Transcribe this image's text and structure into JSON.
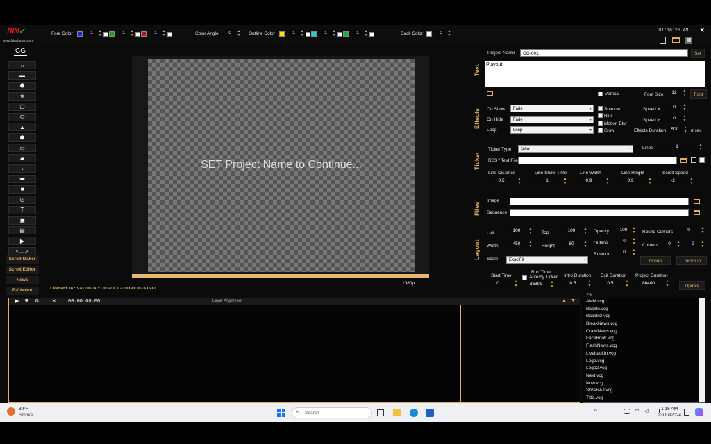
{
  "topbar": {
    "logo_text": "www.binstudeo.com",
    "logo_brand": "BIN",
    "fore_color_label": "Fore Color",
    "color_angle_label": "Color Angle",
    "outline_color_label": "Outline Color",
    "back_color_label": "Back Color",
    "fore_swatches": [
      {
        "color": "#1a2fd0",
        "value": "1"
      },
      {
        "color": "#1fa02a",
        "value": "1"
      },
      {
        "color": "#b01818",
        "value": "1"
      }
    ],
    "angle_value": "0",
    "outline_swatches": [
      {
        "color": "#ffe000",
        "value": "1"
      },
      {
        "color": "#18d0e0",
        "value": "1"
      },
      {
        "color": "#18b030",
        "value": "1"
      }
    ],
    "back_value": "0",
    "clock": "01:16:26 AM",
    "close": "✕"
  },
  "sidebar": {
    "cg_label": "CG",
    "tools": [
      "circle",
      "rounded-rect",
      "pentagon",
      "star",
      "rounded-square",
      "pill",
      "triangle",
      "hexagon",
      "rectangle",
      "parallelogram",
      "crescent",
      "double-arrow",
      "square",
      "clock",
      "text",
      "image",
      "film",
      "video",
      "dots"
    ],
    "dots_label": "<......>",
    "buttons": [
      "Scroll Maker",
      "Scroll Editor",
      "News",
      "E-Choice"
    ]
  },
  "canvas": {
    "message": "SET Project Name to Continue...",
    "resolution": "1080p",
    "license": "Licensed To : SALMAN YOUSAF LAHORE PAKISTA"
  },
  "panel": {
    "project_name_label": "Project Name",
    "project_name_value": "CG-001",
    "set_label": "Set",
    "text_section": "Text",
    "text_value": "Playout",
    "vertical_label": "Vertical",
    "font_size_label": "Font Size",
    "font_size_value": "12",
    "font_label": "Font",
    "effects_section": "Effects",
    "on_show_label": "On Show",
    "on_show_value": "Fade",
    "on_hide_label": "On Hide",
    "on_hide_value": "Fade",
    "loop_label": "Loop",
    "loop_value": "Loop",
    "shadow_label": "Shadow",
    "blur_label": "Blur",
    "motion_blur_label": "Motion Blur",
    "glow_label": "Glow",
    "speed_x_label": "Speed X",
    "speed_x_value": "0",
    "speed_y_label": "Speed Y",
    "speed_y_value": "0",
    "effects_duration_label": "Effects Duration",
    "effects_duration_value": "500",
    "msec_label": "msec",
    "ticker_section": "Ticker",
    "ticker_type_label": "Ticker Type",
    "ticker_type_value": "crawl",
    "lines_label": "Lines",
    "lines_value": "1",
    "rss_label": "RSS / Text File",
    "line_distance_label": "Line Distance",
    "line_distance_value": "0.5",
    "line_show_time_label": "Line Show Time",
    "line_show_time_value": "1",
    "line_width_label": "Line Width",
    "line_width_value": "0.9",
    "line_height_label": "Line Height",
    "line_height_value": "0.9",
    "scroll_speed_label": "Scroll Speed",
    "scroll_speed_value": "-2",
    "files_section": "Files",
    "image_label": "Image",
    "sequence_label": "Sequence",
    "layout_section": "Layout",
    "left_label": "Left",
    "left_value": "100",
    "top_label": "Top",
    "top_value": "100",
    "opacity_label": "Opacity",
    "opacity_value": "100",
    "round_corners_label": "Round Corners",
    "round_corners_value": "0",
    "width_label": "Width",
    "width_value": "450",
    "height_label": "Height",
    "height_value": "80",
    "outline_label": "Outline",
    "outline_value": "0",
    "corners_label": "Corners",
    "corners_value1": "0",
    "corners_value2": "2",
    "rotation_label": "Rotation",
    "rotation_value": "0",
    "scale_label": "Scale",
    "scale_value": "ExactFit",
    "group_label": "Group",
    "ungroup_label": "UnGroup",
    "start_time_label": "Start Time",
    "start_time_value": "0",
    "run_time_label": "Run Time",
    "auto_by_ticker_label": "Auto by Ticker",
    "run_time_value": "86399",
    "intro_duration_label": "Intro Duration",
    "intro_duration_value": "0.5",
    "exit_duration_label": "Exit Duration",
    "exit_duration_value": "0.5",
    "project_duration_label": "Project Duration",
    "project_duration_value": "86400",
    "update_label": "Update"
  },
  "timeline": {
    "timecode": "00:00:00:00",
    "title": "Layer Alignment"
  },
  "files": {
    "header": "vcg",
    "items": [
      "AMN.vcg",
      "BackIn.vcg",
      "BackIn2.vcg",
      "BreakNews.vcg",
      "CrawlNews.vcg",
      "FaceBook.vcg",
      "FlashNews.vcg",
      "LivebackIn.vcg",
      "Logo.vcg",
      "Logo2.vcg",
      "Next.vcg",
      "Now.vcg",
      "SIVARAJ.vcg",
      "Title.vcg"
    ]
  },
  "taskbar": {
    "weather_temp": "89°F",
    "weather_desc": "Smoke",
    "search_placeholder": "Search",
    "time": "1:16 AM",
    "date": "23/Jul/2024"
  }
}
